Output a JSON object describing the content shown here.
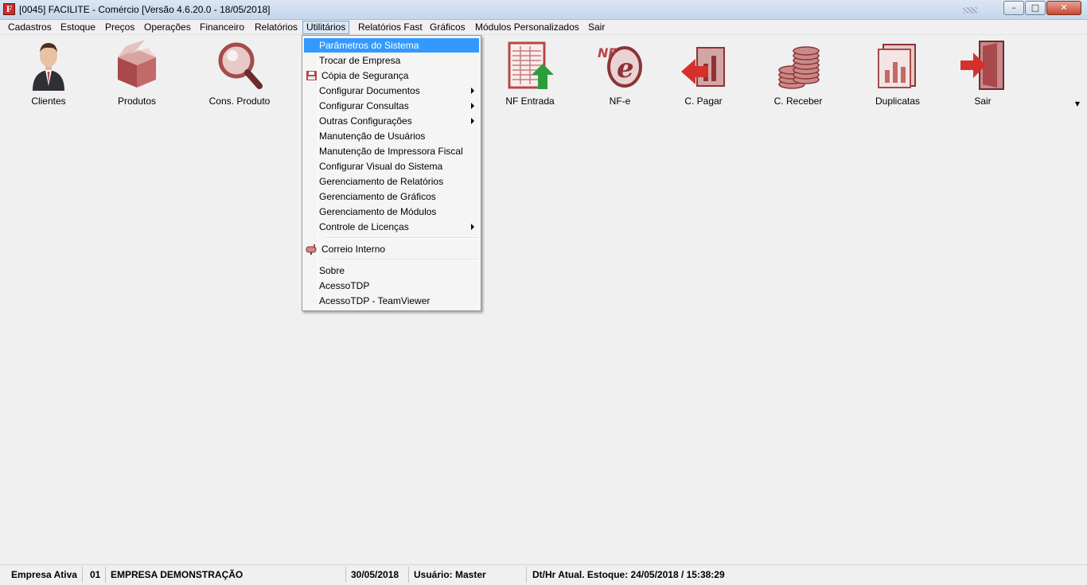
{
  "window": {
    "title": "[0045] FACILITE - Comércio [Versão 4.6.20.0 - 18/05/2018]",
    "app_icon_letter": "F",
    "minimize_icon": "minimize-icon",
    "maximize_icon": "maximize-icon",
    "close_icon": "close-icon",
    "controls": {
      "minimize": "–",
      "maximize": "□",
      "close": "✕"
    }
  },
  "menubar": {
    "items": [
      "Cadastros",
      "Estoque",
      "Preços",
      "Operações",
      "Financeiro",
      "Relatórios",
      "Utilitários",
      "Relatórios Fast",
      "Gráficos",
      "Módulos Personalizados",
      "Sair"
    ],
    "active": "Utilitários"
  },
  "toolbar": {
    "items": [
      {
        "label": "Clientes",
        "icon": "client-person-icon"
      },
      {
        "label": "Produtos",
        "icon": "product-box-icon"
      },
      {
        "label": "Cons. Produto",
        "icon": "magnifier-icon"
      },
      {
        "label": "NF Entrada",
        "icon": "invoice-entry-icon"
      },
      {
        "label": "NF-e",
        "icon": "nfe-icon"
      },
      {
        "label": "C. Pagar",
        "icon": "accounts-payable-icon"
      },
      {
        "label": "C. Receber",
        "icon": "coins-icon"
      },
      {
        "label": "Duplicatas",
        "icon": "duplicates-icon"
      },
      {
        "label": "Sair",
        "icon": "exit-door-icon"
      }
    ]
  },
  "dropdown": {
    "items": [
      {
        "label": "Parâmetros do Sistema",
        "highlighted": true
      },
      {
        "label": "Trocar de Empresa"
      },
      {
        "label": "Cópia de Segurança",
        "icon": "floppy-disk-icon"
      },
      {
        "label": "Configurar Documentos",
        "submenu": true
      },
      {
        "label": "Configurar Consultas",
        "submenu": true
      },
      {
        "label": "Outras Configurações",
        "submenu": true
      },
      {
        "label": "Manutenção de Usuários"
      },
      {
        "label": "Manutenção de Impressora Fiscal"
      },
      {
        "label": "Configurar Visual do Sistema"
      },
      {
        "label": "Gerenciamento de Relatórios"
      },
      {
        "label": "Gerenciamento de Gráficos"
      },
      {
        "label": "Gerenciamento de Módulos"
      },
      {
        "label": "Controle de Licenças",
        "submenu": true
      },
      {
        "label": "Correio Interno",
        "icon": "mailbox-icon"
      },
      {
        "label": "Sobre"
      },
      {
        "label": "AcessoTDP"
      },
      {
        "label": "AcessoTDP - TeamViewer"
      }
    ]
  },
  "statusbar": {
    "empresa_label": "Empresa Ativa",
    "empresa_code": "01",
    "empresa_name": "EMPRESA DEMONSTRAÇÃO",
    "date": "30/05/2018",
    "user": "Usuário: Master",
    "stock_update": "Dt/Hr Atual. Estoque: 24/05/2018 / 15:38:29"
  },
  "colors": {
    "highlight": "#3399ff",
    "icon_red": "#b8474a",
    "icon_green": "#2e9c3a"
  }
}
